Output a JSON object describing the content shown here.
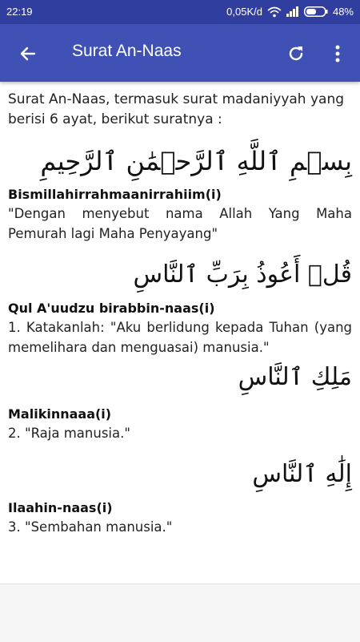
{
  "status_bar": {
    "time": "22:19",
    "network_speed": "0,05K/d",
    "battery_percent": "48%",
    "icons": [
      "wifi-icon",
      "signal-icon",
      "battery-icon"
    ]
  },
  "toolbar": {
    "title": "Surat An-Naas",
    "icons": [
      "back-arrow-icon",
      "refresh-icon",
      "more-vert-icon"
    ],
    "accent_color": "#3f51b5",
    "status_color": "#303f9f"
  },
  "intro": "Surat An-Naas, termasuk surat madaniyyah yang berisi 6 ayat, berikut suratnya :",
  "verses": [
    {
      "arabic": "بِسۡمِ ٱللَّهِ ٱلرَّحۡمَٰنِ ٱلرَّحِيمِ",
      "latin": "Bismillahirrahmaanirrahiim(i)",
      "translation": "\"Dengan menyebut nama Allah Yang Maha Pemurah lagi Maha Penyayang\""
    },
    {
      "arabic": "قُلۡ أَعُوذُ بِرَبِّ ٱلنَّاسِ",
      "latin": "Qul A'uudzu birabbin-naas(i)",
      "translation": "1. Katakanlah: \"Aku berlidung kepada Tuhan (yang memelihara dan menguasai) manusia.\""
    },
    {
      "arabic": "مَلِكِ ٱلنَّاسِ",
      "latin": "Malikinnaaa(i)",
      "translation": "2. \"Raja manusia.\""
    },
    {
      "arabic": "إِلَٰهِ ٱلنَّاسِ",
      "latin": "Ilaahin-naas(i)",
      "translation": "3. \"Sembahan manusia.\""
    }
  ]
}
